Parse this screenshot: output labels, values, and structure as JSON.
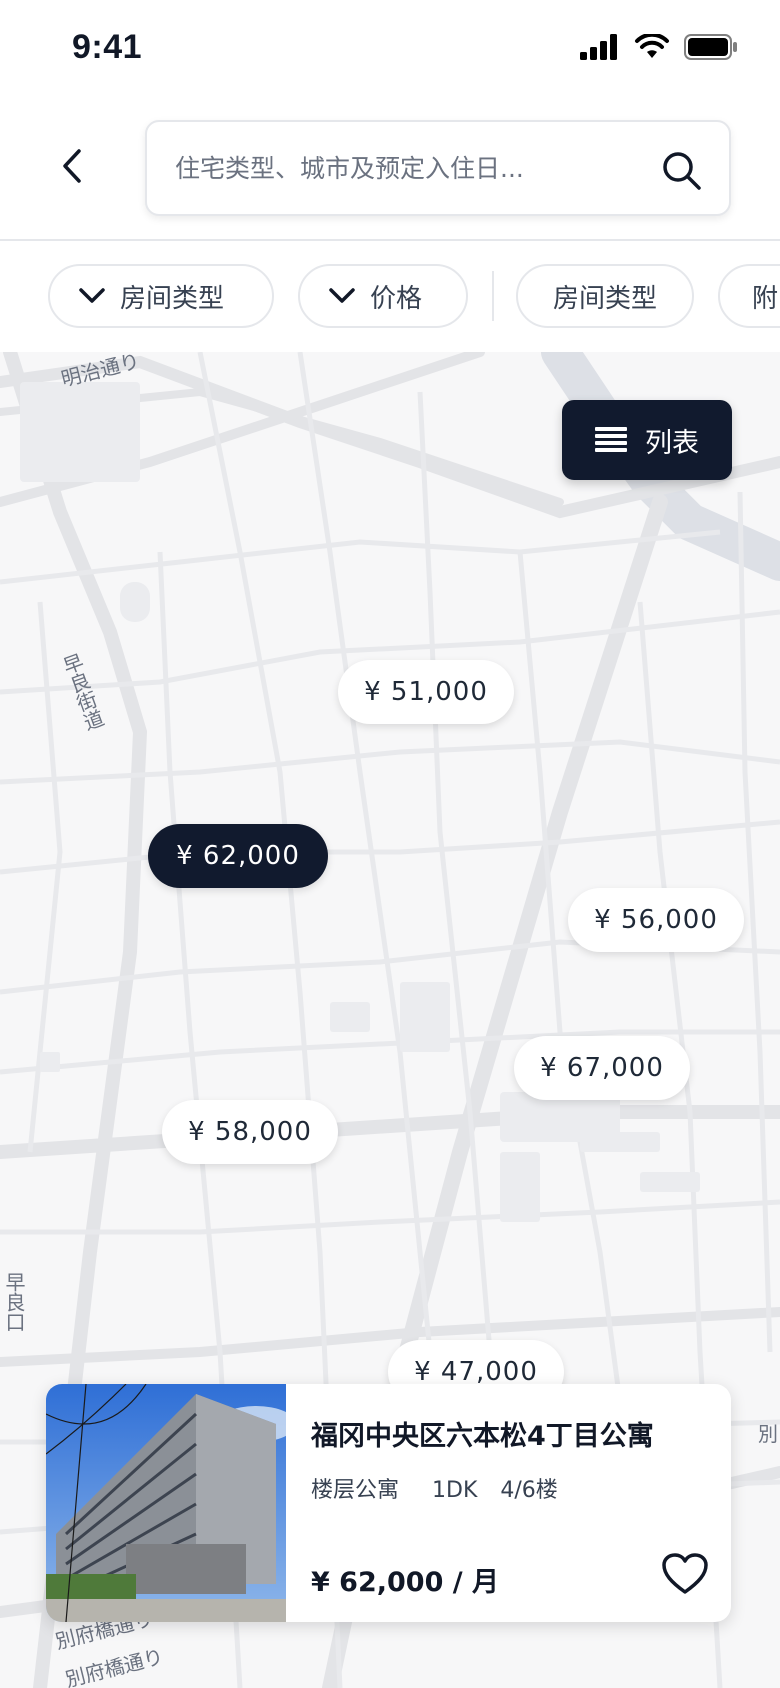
{
  "status_bar": {
    "time": "9:41"
  },
  "header": {
    "search_placeholder": "住宅类型、城市及预定入住日..."
  },
  "filters": {
    "chips": [
      {
        "label": "房间类型",
        "dropdown": true
      },
      {
        "label": "价格",
        "dropdown": true
      },
      {
        "label": "房间类型",
        "dropdown": false
      },
      {
        "label": "附",
        "dropdown": false
      }
    ]
  },
  "map": {
    "list_button_label": "列表",
    "street_labels": [
      "明治通り",
      "早良街道",
      "別府橋通り",
      "別府橋通り",
      "別",
      "早良口"
    ],
    "price_pins": [
      {
        "label": "¥ 51,000",
        "selected": false
      },
      {
        "label": "¥ 62,000",
        "selected": true
      },
      {
        "label": "¥ 56,000",
        "selected": false
      },
      {
        "label": "¥ 67,000",
        "selected": false
      },
      {
        "label": "¥ 58,000",
        "selected": false
      },
      {
        "label": "¥ 47,000",
        "selected": false
      }
    ]
  },
  "card": {
    "title": "福冈中央区六本松4丁目公寓",
    "type": "楼层公寓",
    "layout": "1DK",
    "floor": "4/6楼",
    "price": "¥ 62,000 / 月"
  },
  "colors": {
    "accent": "#111a2e",
    "map_background": "#f7f7f8",
    "road": "#e3e4e7"
  }
}
